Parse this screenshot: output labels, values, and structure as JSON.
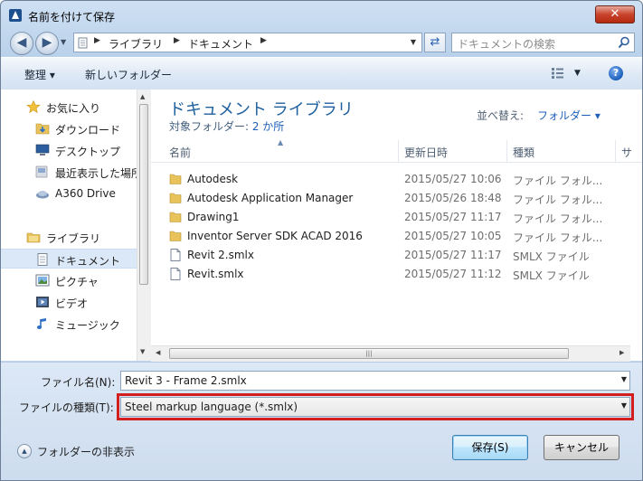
{
  "window": {
    "title": "名前を付けて保存",
    "close_glyph": "✕"
  },
  "address": {
    "crumbs": [
      "ライブラリ",
      "ドキュメント"
    ],
    "search_placeholder": "ドキュメントの検索"
  },
  "toolbar": {
    "organize": "整理 ▾",
    "new_folder": "新しいフォルダー",
    "help_glyph": "?"
  },
  "sidebar": {
    "items": [
      {
        "label": "お気に入り",
        "icon": "star-icon"
      },
      {
        "label": "ダウンロード",
        "icon": "downloads-folder-icon"
      },
      {
        "label": "デスクトップ",
        "icon": "desktop-icon"
      },
      {
        "label": "最近表示した場所",
        "icon": "recent-places-icon"
      },
      {
        "label": "A360 Drive",
        "icon": "cloud-drive-icon"
      },
      {
        "label": "ライブラリ",
        "icon": "library-icon"
      },
      {
        "label": "ドキュメント",
        "icon": "documents-icon",
        "selected": true
      },
      {
        "label": "ピクチャ",
        "icon": "pictures-icon"
      },
      {
        "label": "ビデオ",
        "icon": "videos-icon"
      },
      {
        "label": "ミュージック",
        "icon": "music-icon"
      }
    ]
  },
  "main": {
    "library_title": "ドキュメント ライブラリ",
    "target_prefix": "対象フォルダー: ",
    "target_link": "2 か所",
    "arrange_label": "並べ替え:",
    "arrange_value": "フォルダー ▾",
    "columns": {
      "name": "名前",
      "date": "更新日時",
      "type": "種類",
      "size": "サ"
    },
    "files": [
      {
        "name": "Autodesk",
        "date": "2015/05/27 10:06",
        "type": "ファイル フォル...",
        "kind": "folder"
      },
      {
        "name": "Autodesk Application Manager",
        "date": "2015/05/26 18:48",
        "type": "ファイル フォル...",
        "kind": "folder"
      },
      {
        "name": "Drawing1",
        "date": "2015/05/27 11:17",
        "type": "ファイル フォル...",
        "kind": "folder"
      },
      {
        "name": "Inventor Server SDK ACAD 2016",
        "date": "2015/05/27 10:05",
        "type": "ファイル フォル...",
        "kind": "folder"
      },
      {
        "name": "Revit 2.smlx",
        "date": "2015/05/27 11:17",
        "type": "SMLX ファイル",
        "kind": "file"
      },
      {
        "name": "Revit.smlx",
        "date": "2015/05/27 11:12",
        "type": "SMLX ファイル",
        "kind": "file"
      }
    ]
  },
  "form": {
    "filename_label": "ファイル名(N):",
    "filename_value": "Revit 3 - Frame 2.smlx",
    "filetype_label": "ファイルの種類(T):",
    "filetype_value": "Steel markup language (*.smlx)"
  },
  "footer": {
    "hide_folders": "フォルダーの非表示",
    "save": "保存(S)",
    "cancel": "キャンセル"
  },
  "colors": {
    "highlight": "#d21e1e",
    "accent": "#1e5fb9"
  }
}
